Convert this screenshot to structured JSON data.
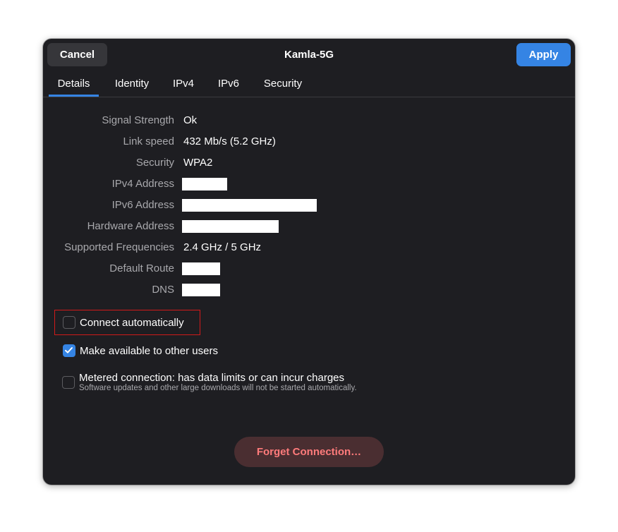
{
  "header": {
    "title": "Kamla-5G",
    "cancel_label": "Cancel",
    "apply_label": "Apply"
  },
  "tabs": [
    {
      "label": "Details",
      "active": true
    },
    {
      "label": "Identity",
      "active": false
    },
    {
      "label": "IPv4",
      "active": false
    },
    {
      "label": "IPv6",
      "active": false
    },
    {
      "label": "Security",
      "active": false
    }
  ],
  "details": {
    "signal_strength": {
      "label": "Signal Strength",
      "value": "Ok"
    },
    "link_speed": {
      "label": "Link speed",
      "value": "432 Mb/s (5.2 GHz)"
    },
    "security": {
      "label": "Security",
      "value": "WPA2"
    },
    "ipv4_address": {
      "label": "IPv4 Address",
      "redacted": true
    },
    "ipv6_address": {
      "label": "IPv6 Address",
      "redacted": true
    },
    "hardware_address": {
      "label": "Hardware Address",
      "redacted": true
    },
    "supported_frequencies": {
      "label": "Supported Frequencies",
      "value": "2.4 GHz / 5 GHz"
    },
    "default_route": {
      "label": "Default Route",
      "redacted": true
    },
    "dns": {
      "label": "DNS",
      "redacted": true
    }
  },
  "options": {
    "connect_automatically": {
      "label": "Connect automatically",
      "checked": false
    },
    "available_to_others": {
      "label": "Make available to other users",
      "checked": true
    },
    "metered": {
      "label": "Metered connection: has data limits or can incur charges",
      "sublabel": "Software updates and other large downloads will not be started automatically.",
      "checked": false
    }
  },
  "forget_label": "Forget Connection…",
  "colors": {
    "background": "#1e1e22",
    "accent": "#3584e4",
    "destructive_text": "#ff7b7b",
    "destructive_bg": "#4a2e31",
    "highlight": "#d11a1a"
  }
}
